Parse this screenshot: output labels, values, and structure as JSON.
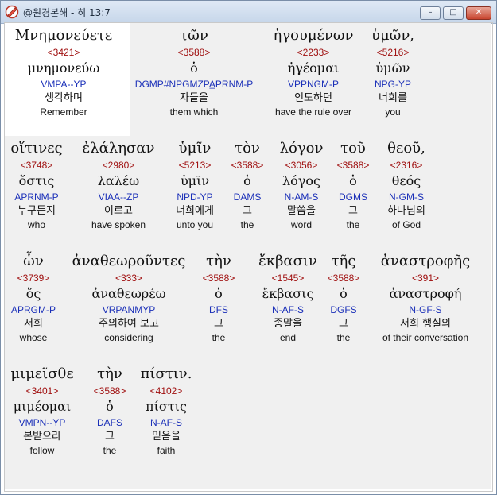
{
  "window": {
    "title": "@원경본해 - 히 13:7",
    "minimize_glyph": "–",
    "maximize_glyph": "□",
    "close_glyph": "✕"
  },
  "words": [
    {
      "greek": "Μνημονεύετε",
      "strong": "<3421>",
      "lemma": "μνημονεύω",
      "parse": "VMPA--YP",
      "korean": "생각하며",
      "english": "Remember"
    },
    {
      "greek": "τῶν",
      "strong": "<3588>",
      "lemma": "ὁ",
      "parse": "DGMP#NPGMZPA̲PRNM-P",
      "korean": "자들을",
      "english": "them which"
    },
    {
      "greek": "ἡγουμένων",
      "strong": "<2233>",
      "lemma": "ἡγέομαι",
      "parse": "VPPNGM-P",
      "korean": "인도하던",
      "english": "have the rule over"
    },
    {
      "greek": "ὑμῶν,",
      "strong": "<5216>",
      "lemma": "ὑμῶν",
      "parse": "NPG-YP",
      "korean": "너희를",
      "english": "you"
    },
    {
      "greek": "οἵτινες",
      "strong": "<3748>",
      "lemma": "ὅστις",
      "parse": "APRNM-P",
      "korean": "누구든지",
      "english": "who"
    },
    {
      "greek": "ἐλάλησαν",
      "strong": "<2980>",
      "lemma": "λαλέω",
      "parse": "VIAA--ZP",
      "korean": "이르고",
      "english": "have spoken"
    },
    {
      "greek": "ὑμῖν",
      "strong": "<5213>",
      "lemma": "ὑμῖν",
      "parse": "NPD-YP",
      "korean": "너희에게",
      "english": "unto you"
    },
    {
      "greek": "τὸν",
      "strong": "<3588>",
      "lemma": "ὁ",
      "parse": "DAMS",
      "korean": "그",
      "english": "the"
    },
    {
      "greek": "λόγον",
      "strong": "<3056>",
      "lemma": "λόγος",
      "parse": "N-AM-S",
      "korean": "말씀을",
      "english": "word"
    },
    {
      "greek": "τοῦ",
      "strong": "<3588>",
      "lemma": "ὁ",
      "parse": "DGMS",
      "korean": "그",
      "english": "the"
    },
    {
      "greek": "θεοῦ,",
      "strong": "<2316>",
      "lemma": "θεός",
      "parse": "N-GM-S",
      "korean": "하나님의",
      "english": "of God"
    },
    {
      "greek": "ὧν",
      "strong": "<3739>",
      "lemma": "ὅς",
      "parse": "APRGM-P",
      "korean": "저희",
      "english": "whose"
    },
    {
      "greek": "ἀναθεωροῦντες",
      "strong": "<333>",
      "lemma": "ἀναθεωρέω",
      "parse": "VRPANMYP",
      "korean": "주의하여 보고",
      "english": "considering"
    },
    {
      "greek": "τὴν",
      "strong": "<3588>",
      "lemma": "ὁ",
      "parse": "DFS",
      "korean": "그",
      "english": "the"
    },
    {
      "greek": "ἔκβασιν",
      "strong": "<1545>",
      "lemma": "ἔκβασις",
      "parse": "N-AF-S",
      "korean": "종말을",
      "english": "end"
    },
    {
      "greek": "τῆς",
      "strong": "<3588>",
      "lemma": "ὁ",
      "parse": "DGFS",
      "korean": "그",
      "english": "the"
    },
    {
      "greek": "ἀναστροφῆς",
      "strong": "<391>",
      "lemma": "ἀναστροφή",
      "parse": "N-GF-S",
      "korean": "저희 행실의",
      "english": "of their conversation"
    },
    {
      "greek": "μιμεῖσθε",
      "strong": "<3401>",
      "lemma": "μιμέομαι",
      "parse": "VMPN--YP",
      "korean": "본받으라",
      "english": "follow"
    },
    {
      "greek": "τὴν",
      "strong": "<3588>",
      "lemma": "ὁ",
      "parse": "DAFS",
      "korean": "그",
      "english": "the"
    },
    {
      "greek": "πίστιν.",
      "strong": "<4102>",
      "lemma": "πίστις",
      "parse": "N-AF-S",
      "korean": "믿음을",
      "english": "faith"
    }
  ]
}
